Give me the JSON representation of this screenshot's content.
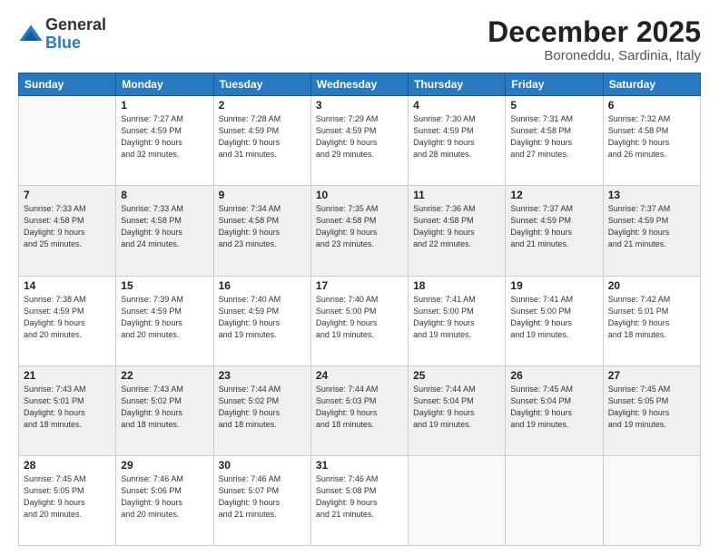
{
  "logo": {
    "general": "General",
    "blue": "Blue"
  },
  "title": "December 2025",
  "location": "Boroneddu, Sardinia, Italy",
  "weekdays": [
    "Sunday",
    "Monday",
    "Tuesday",
    "Wednesday",
    "Thursday",
    "Friday",
    "Saturday"
  ],
  "weeks": [
    [
      {
        "day": "",
        "info": ""
      },
      {
        "day": "1",
        "info": "Sunrise: 7:27 AM\nSunset: 4:59 PM\nDaylight: 9 hours\nand 32 minutes."
      },
      {
        "day": "2",
        "info": "Sunrise: 7:28 AM\nSunset: 4:59 PM\nDaylight: 9 hours\nand 31 minutes."
      },
      {
        "day": "3",
        "info": "Sunrise: 7:29 AM\nSunset: 4:59 PM\nDaylight: 9 hours\nand 29 minutes."
      },
      {
        "day": "4",
        "info": "Sunrise: 7:30 AM\nSunset: 4:59 PM\nDaylight: 9 hours\nand 28 minutes."
      },
      {
        "day": "5",
        "info": "Sunrise: 7:31 AM\nSunset: 4:58 PM\nDaylight: 9 hours\nand 27 minutes."
      },
      {
        "day": "6",
        "info": "Sunrise: 7:32 AM\nSunset: 4:58 PM\nDaylight: 9 hours\nand 26 minutes."
      }
    ],
    [
      {
        "day": "7",
        "info": "Sunrise: 7:33 AM\nSunset: 4:58 PM\nDaylight: 9 hours\nand 25 minutes."
      },
      {
        "day": "8",
        "info": "Sunrise: 7:33 AM\nSunset: 4:58 PM\nDaylight: 9 hours\nand 24 minutes."
      },
      {
        "day": "9",
        "info": "Sunrise: 7:34 AM\nSunset: 4:58 PM\nDaylight: 9 hours\nand 23 minutes."
      },
      {
        "day": "10",
        "info": "Sunrise: 7:35 AM\nSunset: 4:58 PM\nDaylight: 9 hours\nand 23 minutes."
      },
      {
        "day": "11",
        "info": "Sunrise: 7:36 AM\nSunset: 4:58 PM\nDaylight: 9 hours\nand 22 minutes."
      },
      {
        "day": "12",
        "info": "Sunrise: 7:37 AM\nSunset: 4:59 PM\nDaylight: 9 hours\nand 21 minutes."
      },
      {
        "day": "13",
        "info": "Sunrise: 7:37 AM\nSunset: 4:59 PM\nDaylight: 9 hours\nand 21 minutes."
      }
    ],
    [
      {
        "day": "14",
        "info": "Sunrise: 7:38 AM\nSunset: 4:59 PM\nDaylight: 9 hours\nand 20 minutes."
      },
      {
        "day": "15",
        "info": "Sunrise: 7:39 AM\nSunset: 4:59 PM\nDaylight: 9 hours\nand 20 minutes."
      },
      {
        "day": "16",
        "info": "Sunrise: 7:40 AM\nSunset: 4:59 PM\nDaylight: 9 hours\nand 19 minutes."
      },
      {
        "day": "17",
        "info": "Sunrise: 7:40 AM\nSunset: 5:00 PM\nDaylight: 9 hours\nand 19 minutes."
      },
      {
        "day": "18",
        "info": "Sunrise: 7:41 AM\nSunset: 5:00 PM\nDaylight: 9 hours\nand 19 minutes."
      },
      {
        "day": "19",
        "info": "Sunrise: 7:41 AM\nSunset: 5:00 PM\nDaylight: 9 hours\nand 19 minutes."
      },
      {
        "day": "20",
        "info": "Sunrise: 7:42 AM\nSunset: 5:01 PM\nDaylight: 9 hours\nand 18 minutes."
      }
    ],
    [
      {
        "day": "21",
        "info": "Sunrise: 7:43 AM\nSunset: 5:01 PM\nDaylight: 9 hours\nand 18 minutes."
      },
      {
        "day": "22",
        "info": "Sunrise: 7:43 AM\nSunset: 5:02 PM\nDaylight: 9 hours\nand 18 minutes."
      },
      {
        "day": "23",
        "info": "Sunrise: 7:44 AM\nSunset: 5:02 PM\nDaylight: 9 hours\nand 18 minutes."
      },
      {
        "day": "24",
        "info": "Sunrise: 7:44 AM\nSunset: 5:03 PM\nDaylight: 9 hours\nand 18 minutes."
      },
      {
        "day": "25",
        "info": "Sunrise: 7:44 AM\nSunset: 5:04 PM\nDaylight: 9 hours\nand 19 minutes."
      },
      {
        "day": "26",
        "info": "Sunrise: 7:45 AM\nSunset: 5:04 PM\nDaylight: 9 hours\nand 19 minutes."
      },
      {
        "day": "27",
        "info": "Sunrise: 7:45 AM\nSunset: 5:05 PM\nDaylight: 9 hours\nand 19 minutes."
      }
    ],
    [
      {
        "day": "28",
        "info": "Sunrise: 7:45 AM\nSunset: 5:05 PM\nDaylight: 9 hours\nand 20 minutes."
      },
      {
        "day": "29",
        "info": "Sunrise: 7:46 AM\nSunset: 5:06 PM\nDaylight: 9 hours\nand 20 minutes."
      },
      {
        "day": "30",
        "info": "Sunrise: 7:46 AM\nSunset: 5:07 PM\nDaylight: 9 hours\nand 21 minutes."
      },
      {
        "day": "31",
        "info": "Sunrise: 7:46 AM\nSunset: 5:08 PM\nDaylight: 9 hours\nand 21 minutes."
      },
      {
        "day": "",
        "info": ""
      },
      {
        "day": "",
        "info": ""
      },
      {
        "day": "",
        "info": ""
      }
    ]
  ]
}
